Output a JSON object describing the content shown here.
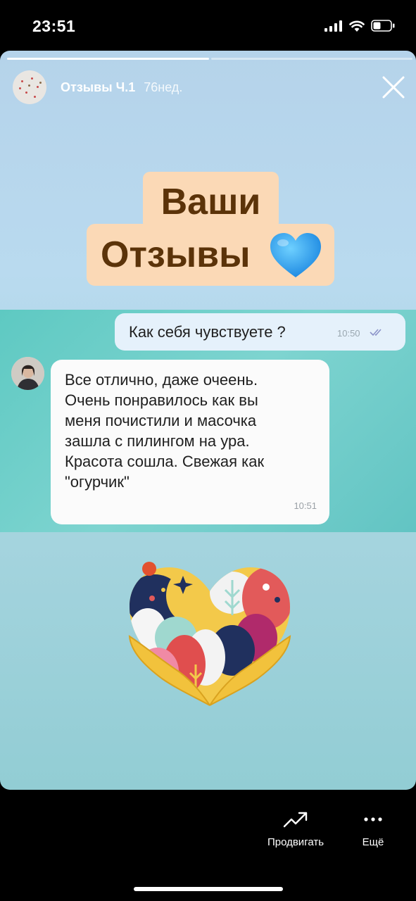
{
  "status_bar": {
    "time": "23:51",
    "icons": [
      "signal-icon",
      "wifi-icon",
      "battery-icon"
    ]
  },
  "story": {
    "segments_total": 2,
    "segments_done": 1,
    "name": "Отзывы Ч.1",
    "age": "76нед.",
    "close_icon": "close-icon",
    "title_line_1": "Ваши",
    "title_line_2": "Отзывы",
    "title_emoji": "blue-heart-icon",
    "chat": {
      "outgoing": {
        "text": "Как себя чувствуете ?",
        "time": "10:50",
        "status_icon": "double-check-icon"
      },
      "incoming": {
        "lines": [
          "Все отлично, даже очеень.",
          "Очень понравилось как вы",
          "меня почистили и масочка",
          "зашла с пилингом на ура.",
          "Красота сошла. Свежая как",
          "\"огурчик\""
        ],
        "time": "10:51"
      }
    },
    "sticker": "hands-heart-illustration"
  },
  "actions": {
    "promote_label": "Продвигать",
    "promote_icon": "trend-arrow-icon",
    "more_label": "Ещё",
    "more_icon": "more-dots-icon"
  },
  "colors": {
    "title_background": "#fbd9b6",
    "title_text": "#5b3309",
    "chat_background": "#5ec9c2",
    "outgoing_bubble": "#e5f1fb",
    "incoming_bubble": "#fbfbfb"
  }
}
